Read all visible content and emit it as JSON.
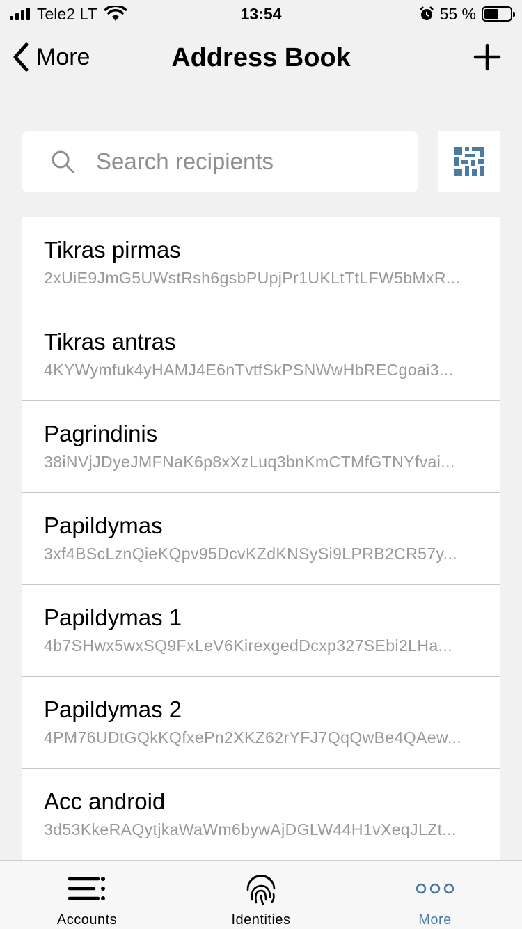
{
  "status_bar": {
    "carrier": "Tele2 LT",
    "time": "13:54",
    "battery_percent": "55 %",
    "battery_level": 0.55
  },
  "nav": {
    "back_label": "More",
    "title": "Address Book"
  },
  "search": {
    "placeholder": "Search recipients"
  },
  "recipients": [
    {
      "name": "Tikras pirmas",
      "address": "2xUiE9JmG5UWstRsh6gsbPUpjPr1UKLtTtLFW5bMxR..."
    },
    {
      "name": "Tikras antras",
      "address": "4KYWymfuk4yHAMJ4E6nTvtfSkPSNWwHbRECgoai3..."
    },
    {
      "name": "Pagrindinis",
      "address": "38iNVjJDyeJMFNaK6p8xXzLuq3bnKmCTMfGTNYfvai..."
    },
    {
      "name": "Papildymas",
      "address": "3xf4BScLznQieKQpv95DcvKZdKNSySi9LPRB2CR57y..."
    },
    {
      "name": "Papildymas 1",
      "address": "4b7SHwx5wxSQ9FxLeV6KirexgedDcxp327SEbi2LHa..."
    },
    {
      "name": "Papildymas 2",
      "address": "4PM76UDtGQkKQfxePn2XKZ62rYFJ7QqQwBe4QAew..."
    },
    {
      "name": "Acc android",
      "address": "3d53KkeRAQytjkaWaWm6bywAjDGLW44H1vXeqJLZt..."
    }
  ],
  "tabs": [
    {
      "label": "Accounts",
      "icon": "accounts-list-icon"
    },
    {
      "label": "Identities",
      "icon": "fingerprint-icon"
    },
    {
      "label": "More",
      "icon": "more-dots-icon",
      "active": true
    }
  ],
  "colors": {
    "accent": "#4b7ba4",
    "background": "#f1f1f1",
    "secondary_text": "#999999"
  }
}
